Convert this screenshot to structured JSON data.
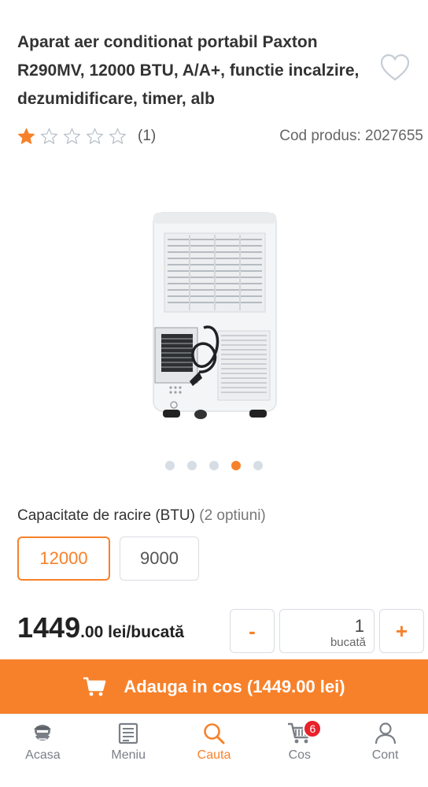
{
  "product": {
    "title": "Aparat aer conditionat portabil Paxton R290MV, 12000 BTU, A/A+, functie incalzire, dezumidificare, timer, alb",
    "rating_value": 1,
    "rating_max": 5,
    "rating_count": "(1)",
    "code_label": "Cod produs: 2027655"
  },
  "gallery": {
    "image_count": 5,
    "active_index": 3
  },
  "options": {
    "label": "Capacitate de racire (BTU)",
    "count_text": "(2 optiuni)",
    "items": [
      {
        "label": "12000",
        "selected": true
      },
      {
        "label": "9000",
        "selected": false
      }
    ]
  },
  "price": {
    "integer": "1449",
    "decimals_unit": ".00 lei/bucată"
  },
  "quantity": {
    "minus": "-",
    "plus": "+",
    "value": "1",
    "unit": "bucată"
  },
  "cart_button": {
    "label": "Adauga in cos (1449.00 lei)"
  },
  "nav": {
    "items": [
      {
        "label": "Acasa",
        "icon": "home-mascot-icon"
      },
      {
        "label": "Meniu",
        "icon": "menu-list-icon"
      },
      {
        "label": "Cauta",
        "icon": "search-icon"
      },
      {
        "label": "Cos",
        "icon": "cart-icon",
        "badge": "6"
      },
      {
        "label": "Cont",
        "icon": "user-icon"
      }
    ],
    "active": "Cauta"
  },
  "colors": {
    "accent": "#f7812a",
    "badge": "#e8212b",
    "text": "#333333",
    "muted": "#7a7f86"
  }
}
